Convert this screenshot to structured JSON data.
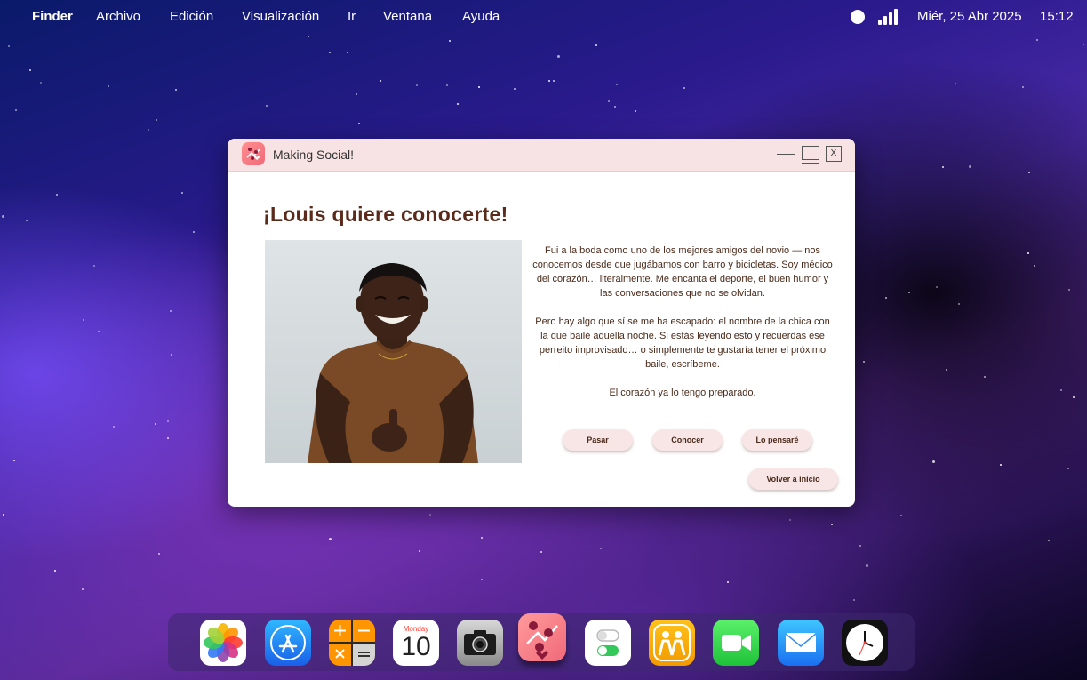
{
  "menubar": {
    "items": [
      "Finder",
      "Archivo",
      "Edición",
      "Visualización",
      "Ir",
      "Ventana",
      "Ayuda"
    ],
    "date": "Miér, 25 Abr 2025",
    "time": "15:12"
  },
  "window": {
    "title": "Making Social!",
    "close_label": "X"
  },
  "profile": {
    "heading": "¡Louis quiere conocerte!",
    "bio": [
      "Fui a la boda como uno de los mejores amigos del novio — nos conocemos desde que jugábamos con barro y bicicletas. Soy médico del corazón… literalmente. Me encanta el deporte, el buen humor y las conversaciones que no se olvidan.",
      "Pero hay algo que sí se me ha escapado: el nombre de la chica con la que bailé aquella noche. Si estás leyendo esto y recuerdas ese perreito improvisado… o simplemente te gustaría tener el próximo baile, escríbeme.",
      "El corazón ya lo tengo preparado."
    ]
  },
  "actions": {
    "pass": "Pasar",
    "meet": "Conocer",
    "think": "Lo pensaré",
    "home": "Volver a inicio"
  },
  "dock": {
    "calendar_day_name": "Monday",
    "calendar_day_number": "10",
    "apps": [
      "photos-icon",
      "app-store-icon",
      "calculator-icon",
      "calendar-icon",
      "camera-icon",
      "making-social-icon",
      "settings-icon",
      "find-my-friends-icon",
      "facetime-icon",
      "mail-icon",
      "clock-icon"
    ]
  },
  "colors": {
    "title_bar": "#f7e3e3",
    "heading": "#5a2a1a",
    "button": "#f8e6e6"
  }
}
